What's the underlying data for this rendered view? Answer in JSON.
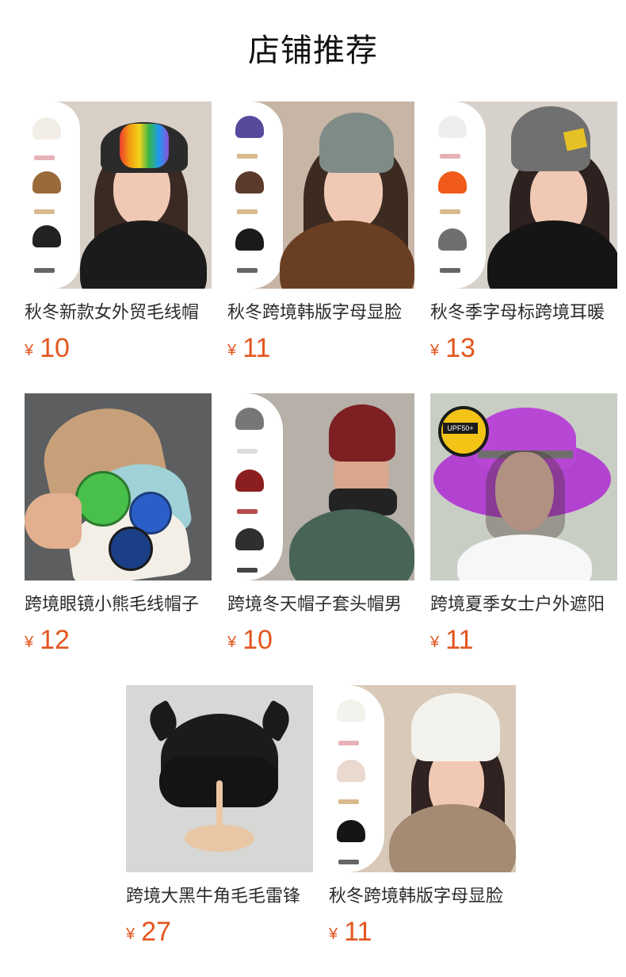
{
  "header": {
    "title": "店铺推荐"
  },
  "products": [
    {
      "name": "秋冬新款女外贸毛线帽",
      "currency": "¥",
      "price": "10"
    },
    {
      "name": "秋冬跨境韩版字母显脸",
      "currency": "¥",
      "price": "11"
    },
    {
      "name": "秋冬季字母标跨境耳暖",
      "currency": "¥",
      "price": "13"
    },
    {
      "name": "跨境眼镜小熊毛线帽子",
      "currency": "¥",
      "price": "12"
    },
    {
      "name": "跨境冬天帽子套头帽男",
      "currency": "¥",
      "price": "10"
    },
    {
      "name": "跨境夏季女士户外遮阳",
      "currency": "¥",
      "price": "11"
    },
    {
      "name": "跨境大黑牛角毛毛雷锋",
      "currency": "¥",
      "price": "27"
    },
    {
      "name": "秋冬跨境韩版字母显脸",
      "currency": "¥",
      "price": "11"
    }
  ],
  "images": {
    "colors": {
      "rainbow": [
        "#ef3d2f",
        "#f39c12",
        "#f5d31f",
        "#38b449",
        "#1d9bf0",
        "#8c4fd7"
      ],
      "red": "#9f2b2b",
      "charcoal": "#333333",
      "cream": "#f2eee6",
      "brown": "#7a4a2a",
      "gray": "#7d7d7d",
      "purple": "#b23fd3",
      "beige": "#c7a07a",
      "black": "#111111",
      "white": "#f7f7f7"
    },
    "labels": {
      "upf": "UPF50+"
    }
  }
}
